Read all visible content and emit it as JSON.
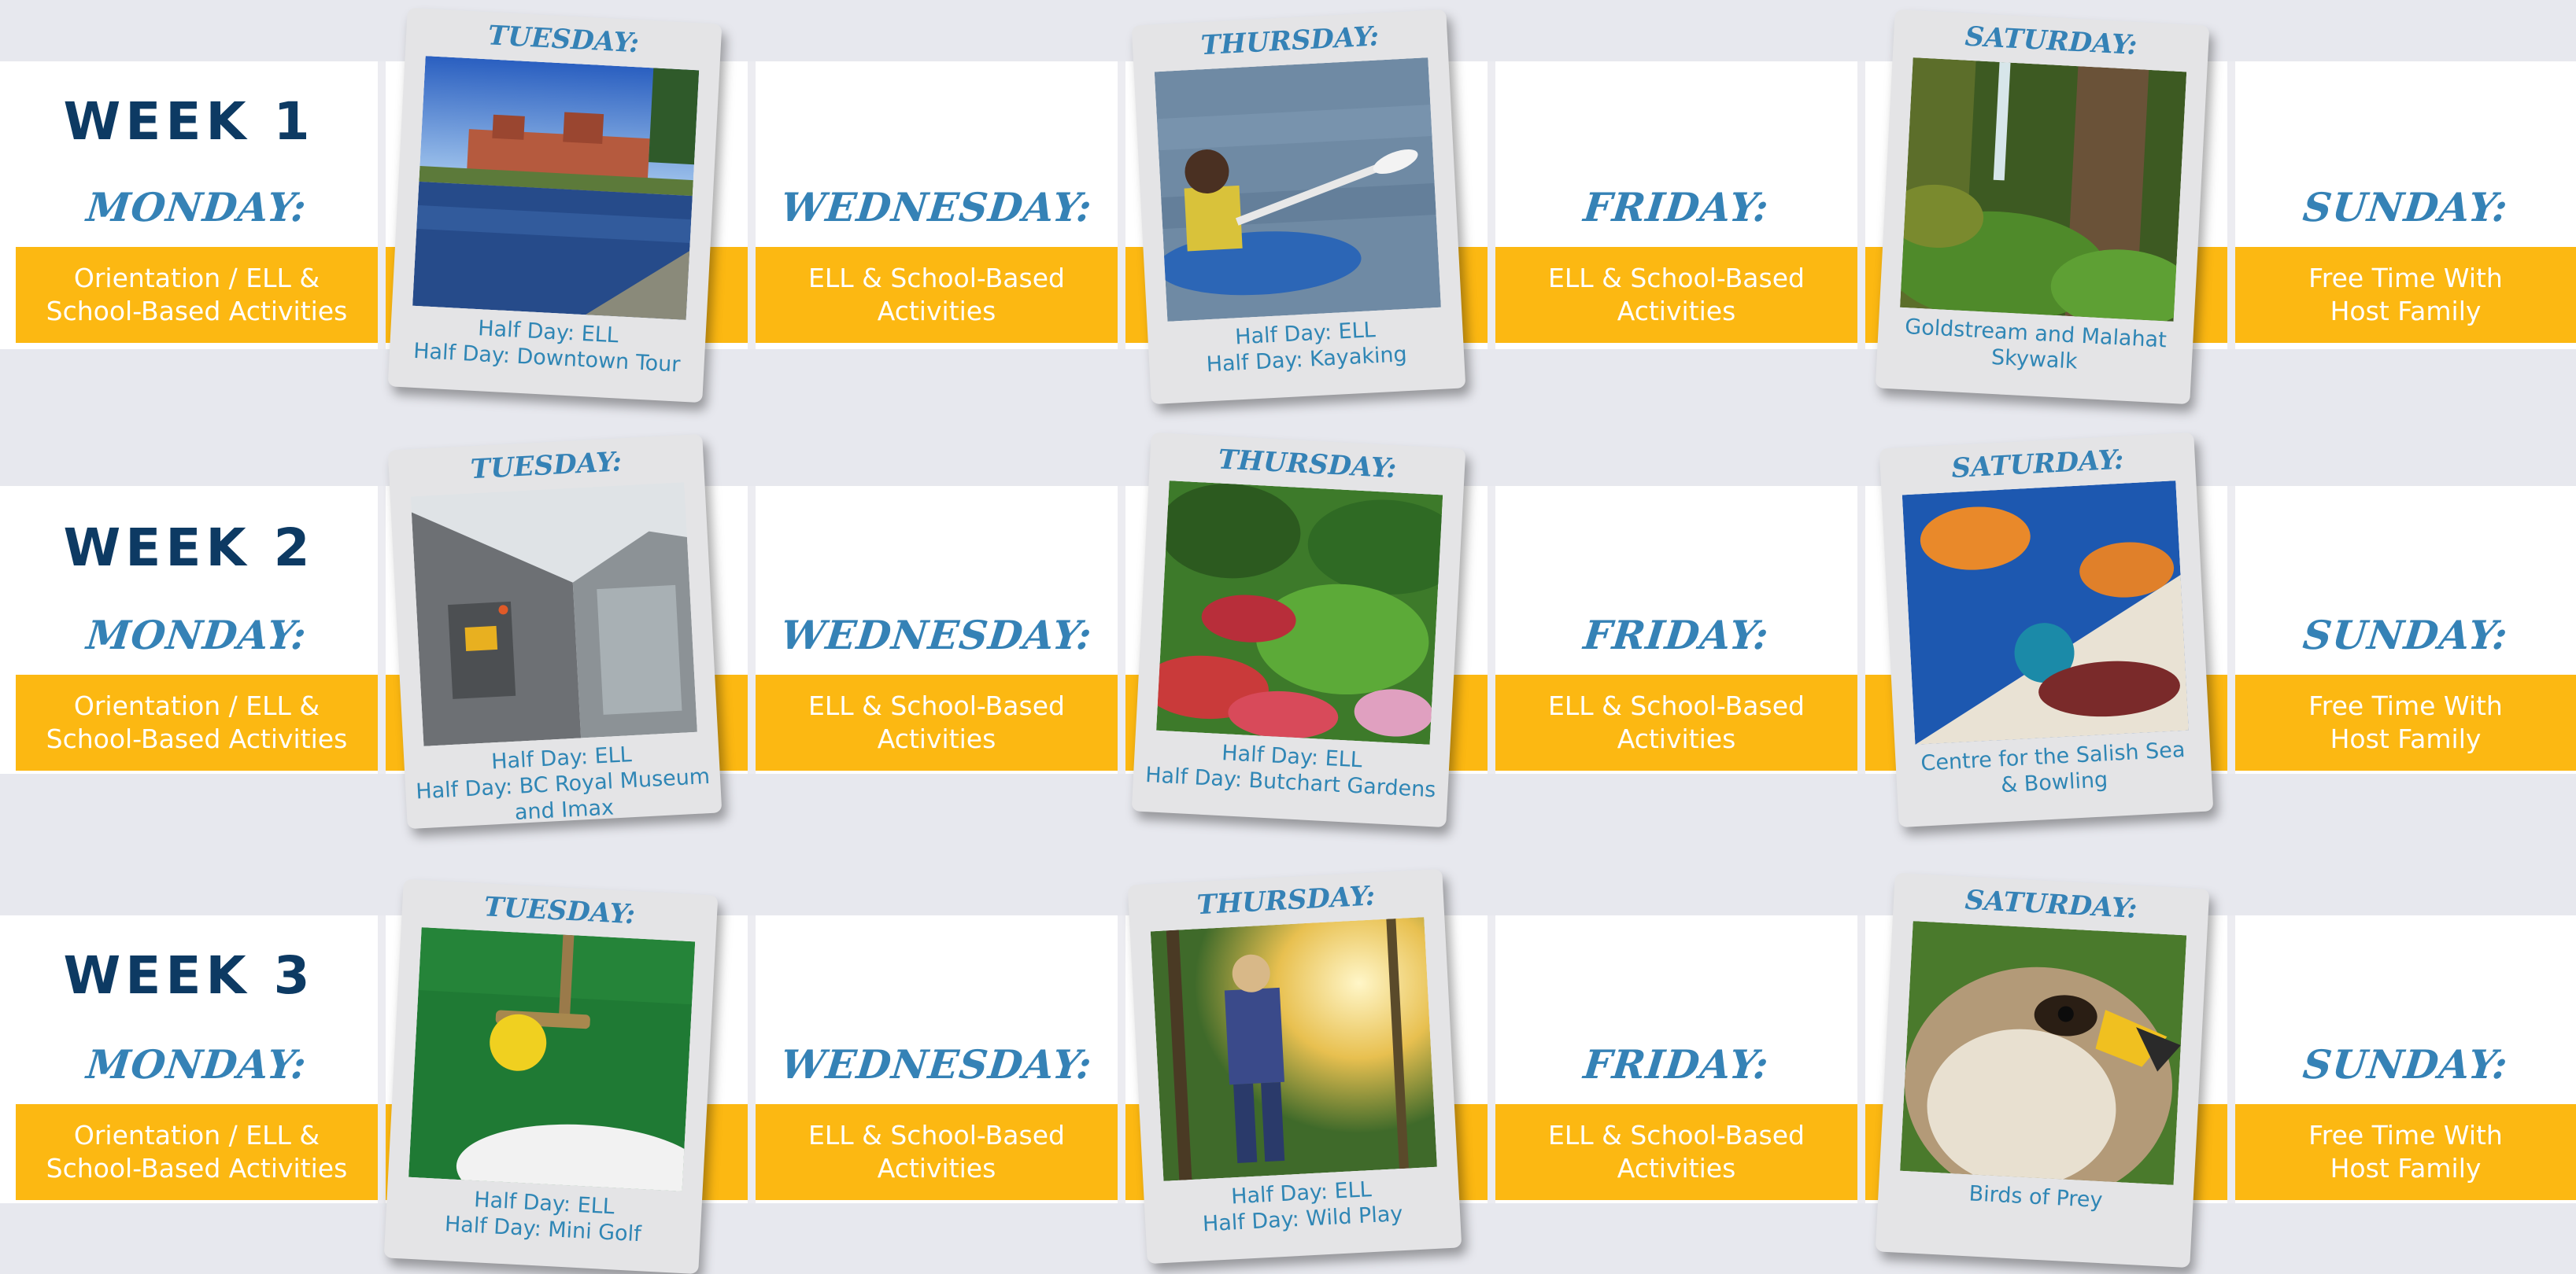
{
  "colors": {
    "background": "#e7e8ee",
    "band": "#ffffff",
    "bar": "#fcb812",
    "title": "#0d3a63",
    "day": "#3582b6",
    "caption": "#2f86b5"
  },
  "weeks": [
    {
      "title": "WEEK 1",
      "monday": {
        "label": "MONDAY:",
        "activity": "Orientation / ELL &\nSchool-Based Activities"
      },
      "tuesday": {
        "label": "TUESDAY:",
        "caption": "Half Day: ELL\nHalf Day: Downtown Tour",
        "image": "downtown-harbour-photo"
      },
      "wednesday": {
        "label": "WEDNESDAY:",
        "activity": "ELL & School-Based\nActivities"
      },
      "thursday": {
        "label": "THURSDAY:",
        "caption": "Half Day: ELL\nHalf Day: Kayaking",
        "image": "kayaking-photo"
      },
      "friday": {
        "label": "FRIDAY:",
        "activity": "ELL & School-Based\nActivities"
      },
      "saturday": {
        "label": "SATURDAY:",
        "caption": "Goldstream and Malahat\nSkywalk",
        "image": "forest-waterfall-photo"
      },
      "sunday": {
        "label": "SUNDAY:",
        "activity": "Free Time With\nHost Family"
      }
    },
    {
      "title": "WEEK 2",
      "monday": {
        "label": "MONDAY:",
        "activity": "Orientation / ELL &\nSchool-Based Activities"
      },
      "tuesday": {
        "label": "TUESDAY:",
        "caption": "Half Day: ELL\nHalf Day: BC Royal Museum\nand Imax",
        "image": "museum-building-photo"
      },
      "wednesday": {
        "label": "WEDNESDAY:",
        "activity": "ELL & School-Based\nActivities"
      },
      "thursday": {
        "label": "THURSDAY:",
        "caption": "Half Day: ELL\nHalf Day: Butchart Gardens",
        "image": "gardens-photo"
      },
      "friday": {
        "label": "FRIDAY:",
        "activity": "ELL & School-Based\nActivities"
      },
      "saturday": {
        "label": "SATURDAY:",
        "caption": "Centre for the Salish Sea\n& Bowling",
        "image": "jellyfish-bowling-photo"
      },
      "sunday": {
        "label": "SUNDAY:",
        "activity": "Free Time With\nHost Family"
      }
    },
    {
      "title": "WEEK 3",
      "monday": {
        "label": "MONDAY:",
        "activity": "Orientation / ELL &\nSchool-Based Activities"
      },
      "tuesday": {
        "label": "TUESDAY:",
        "caption": "Half Day: ELL\nHalf Day: Mini Golf",
        "image": "mini-golf-photo"
      },
      "wednesday": {
        "label": "WEDNESDAY:",
        "activity": "ELL & School-Based\nActivities"
      },
      "thursday": {
        "label": "THURSDAY:",
        "caption": "Half Day: ELL\nHalf Day: Wild Play",
        "image": "wild-play-photo"
      },
      "friday": {
        "label": "FRIDAY:",
        "activity": "ELL & School-Based\nActivities"
      },
      "saturday": {
        "label": "SATURDAY:",
        "caption": "Birds of Prey",
        "image": "hawk-photo"
      },
      "sunday": {
        "label": "SUNDAY:",
        "activity": "Free Time With\nHost Family"
      }
    }
  ]
}
